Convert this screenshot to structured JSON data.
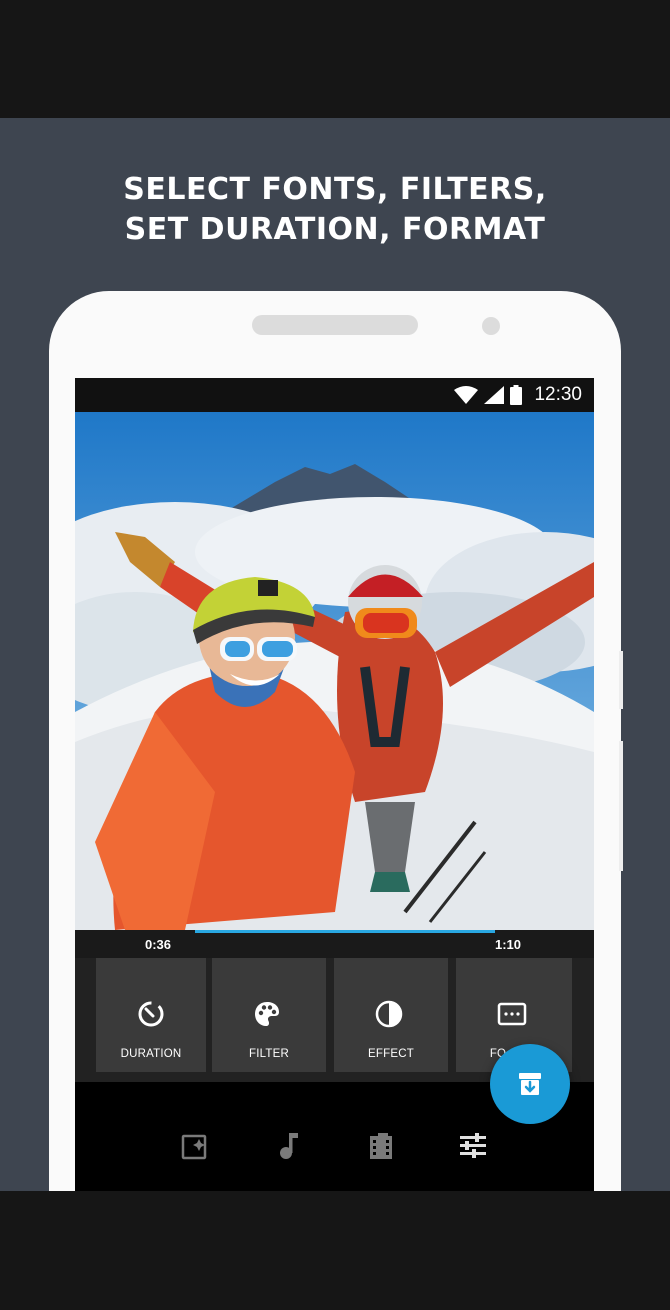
{
  "headline": {
    "line1": "SELECT FONTS, FILTERS,",
    "line2": "SET DURATION, FORMAT"
  },
  "status_bar": {
    "time": "12:30",
    "icons": [
      "wifi-icon",
      "signal-icon",
      "battery-icon"
    ]
  },
  "timeline": {
    "start_time": "0:36",
    "end_time": "1:10"
  },
  "tools": [
    {
      "label": "DURATION",
      "icon": "timer-icon"
    },
    {
      "label": "FILTER",
      "icon": "palette-icon"
    },
    {
      "label": "EFFECT",
      "icon": "contrast-icon"
    },
    {
      "label": "FO",
      "icon": "format-icon"
    }
  ],
  "fab": {
    "icon": "save-archive-icon"
  },
  "bottom_nav": {
    "items": [
      "sparkle-photo-icon",
      "music-note-icon",
      "film-icon",
      "tune-sliders-icon"
    ],
    "active_index": 3
  },
  "colors": {
    "background": "#3e4550",
    "accent": "#1a9ad6",
    "tool_button": "#3a3a3a"
  }
}
